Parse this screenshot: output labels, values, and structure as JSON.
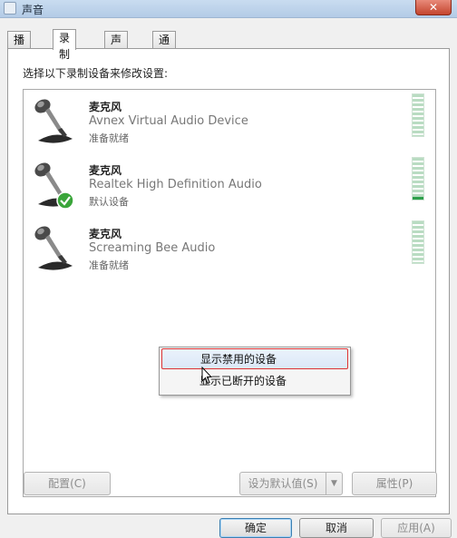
{
  "window": {
    "title": "声音",
    "close_label": "✕"
  },
  "tabs": [
    {
      "label": "播放",
      "active": false
    },
    {
      "label": "录制",
      "active": true
    },
    {
      "label": "声音",
      "active": false
    },
    {
      "label": "通信",
      "active": false
    }
  ],
  "instruction": "选择以下录制设备来修改设置:",
  "devices": [
    {
      "name": "麦克风",
      "description": "Avnex Virtual Audio Device",
      "status": "准备就绪",
      "is_default": false,
      "level": 0.0
    },
    {
      "name": "麦克风",
      "description": "Realtek High Definition Audio",
      "status": "默认设备",
      "is_default": true,
      "level": 0.05
    },
    {
      "name": "麦克风",
      "description": "Screaming Bee Audio",
      "status": "准备就绪",
      "is_default": false,
      "level": 0.0
    }
  ],
  "context_menu": {
    "items": [
      {
        "label": "显示禁用的设备",
        "highlighted": true
      },
      {
        "label": "显示已断开的设备",
        "highlighted": false
      }
    ]
  },
  "buttons": {
    "configure": "配置(C)",
    "set_default": "设为默认值(S)",
    "properties": "属性(P)",
    "ok": "确定",
    "cancel": "取消",
    "apply": "应用(A)"
  },
  "colors": {
    "default_check": "#3aa53a",
    "meter_active": "#2d9f4a",
    "menu_highlight_border": "#dd3333"
  }
}
